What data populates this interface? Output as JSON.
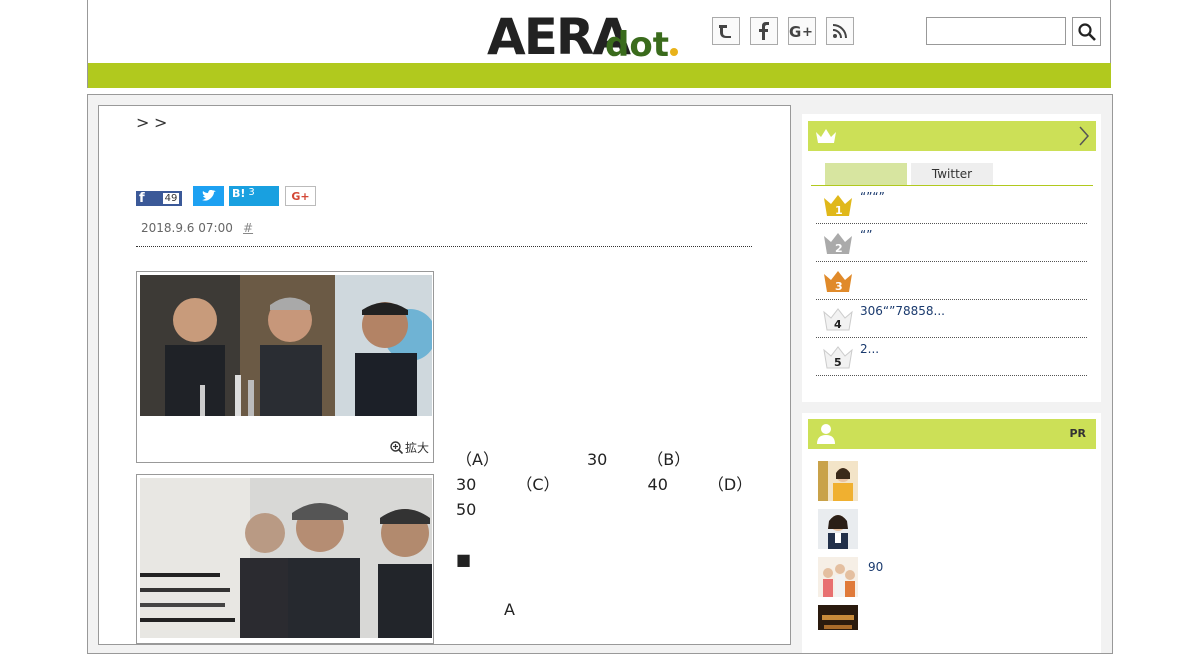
{
  "header": {
    "logo_text": "AERA",
    "logo_sub": "dot.",
    "social_icons": [
      "twitter-icon",
      "facebook-icon",
      "google-plus-icon",
      "rss-icon"
    ],
    "search_placeholder": ""
  },
  "breadcrumb": [
    ">",
    ">"
  ],
  "share": {
    "facebook_count": "49",
    "hatena_label": "B!",
    "hatena_count": "3",
    "google_label": "G+"
  },
  "meta": {
    "date": "2018.9.6 07:00",
    "hash": "#"
  },
  "photos": [
    {
      "zoom_label": "拡大"
    }
  ],
  "article": {
    "para1": "",
    "link": "",
    "para2": "（A）　　　　　　30　　　（B）　　　　　　30　　　（C）　　　　　　40　　　（D）　　　　　　　50　　　",
    "para3_a": "",
    "para3_b": "■　　　　　　　 　　　　　　　",
    "para4": "　　　A　　　　　　　　　　　　　　　　　　　　　　　　　　　　　　　　　　　　　　　　"
  },
  "ranking": {
    "tabs": [
      "",
      "Twitter"
    ],
    "items": [
      {
        "rank": "1",
        "text": "“”“”"
      },
      {
        "rank": "2",
        "text": "“”"
      },
      {
        "rank": "3",
        "text": ""
      },
      {
        "rank": "4",
        "text": "306“”78858..."
      },
      {
        "rank": "5",
        "text": "2..."
      }
    ]
  },
  "pr": {
    "label": "PR",
    "items": [
      {
        "text": ""
      },
      {
        "text": ""
      },
      {
        "text": "90"
      },
      {
        "text": ""
      }
    ]
  },
  "colors": {
    "brand_green": "#b1c91e",
    "side_head": "#cce057",
    "gold": "#e0b81a",
    "silver": "#aaaaaa",
    "bronze": "#e08a2a",
    "link": "#1a3a6e"
  }
}
